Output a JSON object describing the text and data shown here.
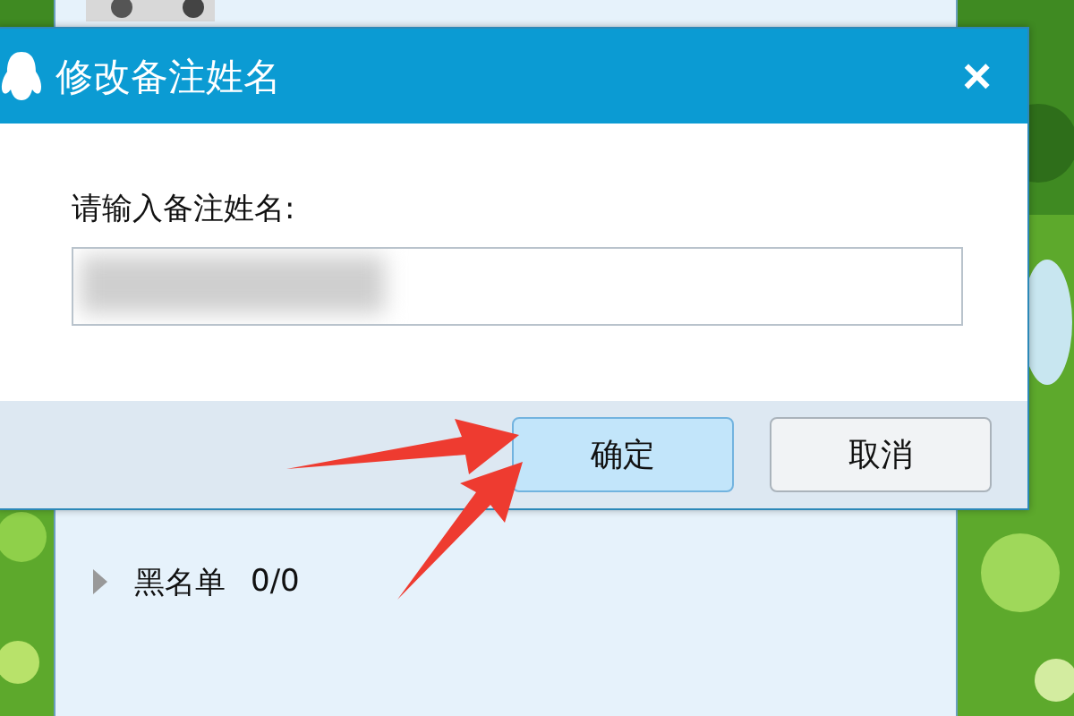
{
  "contacts_panel": {
    "groups": [
      {
        "label": "黑名单",
        "count": "0/0",
        "expanded": false
      }
    ]
  },
  "dialog": {
    "title": "修改备注姓名",
    "close": "×",
    "prompt": "请输入备注姓名:",
    "field": {
      "redacted": true
    },
    "buttons": [
      {
        "label": "确定",
        "default": true
      },
      {
        "label": "取消",
        "default": false
      }
    ]
  },
  "annotations": [
    {
      "kind": "arrow"
    },
    {
      "kind": "arrow"
    }
  ]
}
